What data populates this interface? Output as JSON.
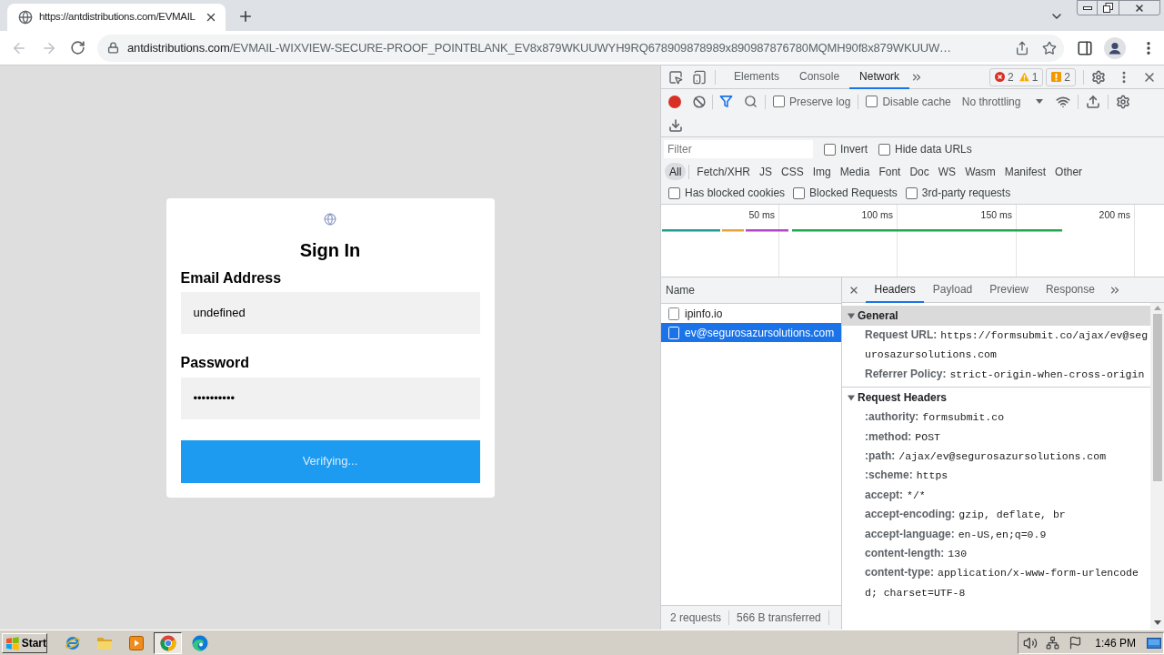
{
  "browser": {
    "tab": {
      "title": "https://antdistributions.com/EVMAIL"
    },
    "back": {
      "disabled": true
    },
    "forward": {
      "disabled": true
    },
    "address": {
      "host": "antdistributions.com",
      "path": "/EVMAIL-WIXVIEW-SECURE-PROOF_POINTBLANK_EV8x879WKUUWYH9RQ678909878989x890987876780MQMH90f8x879WKUUW…"
    }
  },
  "page": {
    "title": "Sign In",
    "fields": [
      {
        "label": "Email Address",
        "value": "undefined"
      },
      {
        "label": "Password",
        "value": "••••••••••"
      }
    ],
    "button": "Verifying..."
  },
  "devtools": {
    "tabs": [
      {
        "label": "Elements",
        "selected": false
      },
      {
        "label": "Console",
        "selected": false
      },
      {
        "label": "Network",
        "selected": true
      }
    ],
    "counts": {
      "errors": "2",
      "warnings": "1",
      "issues": "2"
    },
    "toolbar": {
      "recording": true,
      "options": [
        {
          "label": "Preserve log",
          "checked": false
        },
        {
          "label": "Disable cache",
          "checked": false
        }
      ],
      "throttling": "No throttling"
    },
    "filter": {
      "placeholder": "Filter",
      "options": [
        {
          "label": "Invert",
          "checked": false
        },
        {
          "label": "Hide data URLs",
          "checked": false
        }
      ]
    },
    "types": [
      {
        "label": "All",
        "selected": true
      },
      {
        "label": "Fetch/XHR",
        "selected": false
      },
      {
        "label": "JS",
        "selected": false
      },
      {
        "label": "CSS",
        "selected": false
      },
      {
        "label": "Img",
        "selected": false
      },
      {
        "label": "Media",
        "selected": false
      },
      {
        "label": "Font",
        "selected": false
      },
      {
        "label": "Doc",
        "selected": false
      },
      {
        "label": "WS",
        "selected": false
      },
      {
        "label": "Wasm",
        "selected": false
      },
      {
        "label": "Manifest",
        "selected": false
      },
      {
        "label": "Other",
        "selected": false
      }
    ],
    "more_filters": [
      {
        "label": "Has blocked cookies",
        "checked": false
      },
      {
        "label": "Blocked Requests",
        "checked": false
      },
      {
        "label": "3rd-party requests",
        "checked": false
      }
    ],
    "overview": {
      "ticks": [
        "50 ms",
        "100 ms",
        "150 ms",
        "200 ms"
      ]
    },
    "requests": {
      "column": "Name",
      "rows": [
        {
          "name": "ipinfo.io",
          "selected": false
        },
        {
          "name": "ev@segurosazursolutions.com",
          "selected": true
        }
      ],
      "summary": [
        "2 requests",
        "566 B transferred"
      ]
    },
    "details": {
      "tabs": [
        {
          "label": "Headers",
          "selected": true
        },
        {
          "label": "Payload",
          "selected": false
        },
        {
          "label": "Preview",
          "selected": false
        },
        {
          "label": "Response",
          "selected": false
        }
      ],
      "sections": [
        {
          "title": "General",
          "expanded": true,
          "selected": true,
          "rows": [
            {
              "name": "Request URL:",
              "value": "https://formsubmit.co/ajax/ev@segurosazursolutions.com"
            },
            {
              "name": "Referrer Policy:",
              "value": "strict-origin-when-cross-origin"
            }
          ]
        },
        {
          "title": "Request Headers",
          "expanded": true,
          "selected": false,
          "rows": [
            {
              "name": ":authority:",
              "value": "formsubmit.co"
            },
            {
              "name": ":method:",
              "value": "POST"
            },
            {
              "name": ":path:",
              "value": "/ajax/ev@segurosazursolutions.com"
            },
            {
              "name": ":scheme:",
              "value": "https"
            },
            {
              "name": "accept:",
              "value": "*/*"
            },
            {
              "name": "accept-encoding:",
              "value": "gzip, deflate, br"
            },
            {
              "name": "accept-language:",
              "value": "en-US,en;q=0.9"
            },
            {
              "name": "content-length:",
              "value": "130"
            },
            {
              "name": "content-type:",
              "value": "application/x-www-form-urlencoded; charset=UTF-8"
            }
          ]
        }
      ]
    }
  },
  "taskbar": {
    "start": "Start",
    "apps": [
      {
        "kind": "e-browser",
        "selected": false
      },
      {
        "kind": "folder",
        "selected": false
      },
      {
        "kind": "player",
        "selected": false
      },
      {
        "kind": "round-browser",
        "selected": true
      },
      {
        "kind": "wave-browser",
        "selected": false
      }
    ],
    "clock": "1:46 PM"
  }
}
